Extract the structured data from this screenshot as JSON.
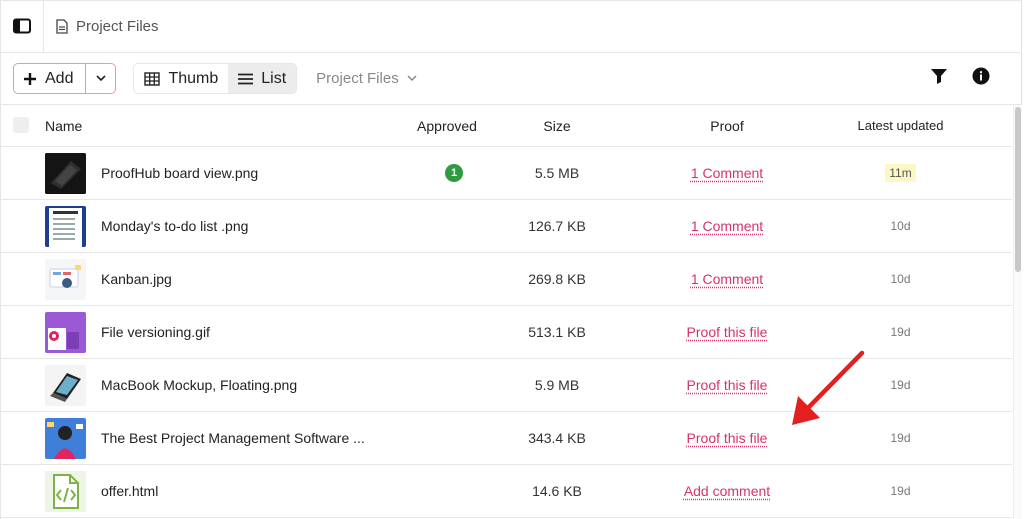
{
  "breadcrumb": {
    "title": "Project Files"
  },
  "toolbar": {
    "add_label": "Add",
    "thumb_label": "Thumb",
    "list_label": "List",
    "folder_label": "Project Files"
  },
  "table": {
    "columns": {
      "name": "Name",
      "approved": "Approved",
      "size": "Size",
      "proof": "Proof",
      "updated": "Latest updated"
    },
    "rows": [
      {
        "name": "ProofHub board view.png",
        "approved": "1",
        "size": "5.5 MB",
        "proof": "1 Comment",
        "updated": "11m"
      },
      {
        "name": "Monday's to-do list .png",
        "approved": "",
        "size": "126.7 KB",
        "proof": "1 Comment",
        "updated": "10d"
      },
      {
        "name": "Kanban.jpg",
        "approved": "",
        "size": "269.8 KB",
        "proof": "1 Comment",
        "updated": "10d"
      },
      {
        "name": "File versioning.gif",
        "approved": "",
        "size": "513.1 KB",
        "proof": "Proof this file",
        "updated": "19d"
      },
      {
        "name": "MacBook Mockup, Floating.png",
        "approved": "",
        "size": "5.9 MB",
        "proof": "Proof this file",
        "updated": "19d"
      },
      {
        "name": "The Best Project Management Software ...",
        "approved": "",
        "size": "343.4 KB",
        "proof": "Proof this file",
        "updated": "19d"
      },
      {
        "name": "offer.html",
        "approved": "",
        "size": "14.6 KB",
        "proof": "Add comment",
        "updated": "19d"
      }
    ]
  },
  "colors": {
    "accent": "#d6336c",
    "approved": "#2e9c3e",
    "arrow": "#e32020",
    "highlight": "#fdf7c3"
  },
  "icons": [
    "sidebar-icon",
    "file-icon",
    "plus-icon",
    "chevron-down-icon",
    "grid-icon",
    "list-icon",
    "filter-icon",
    "info-icon"
  ]
}
